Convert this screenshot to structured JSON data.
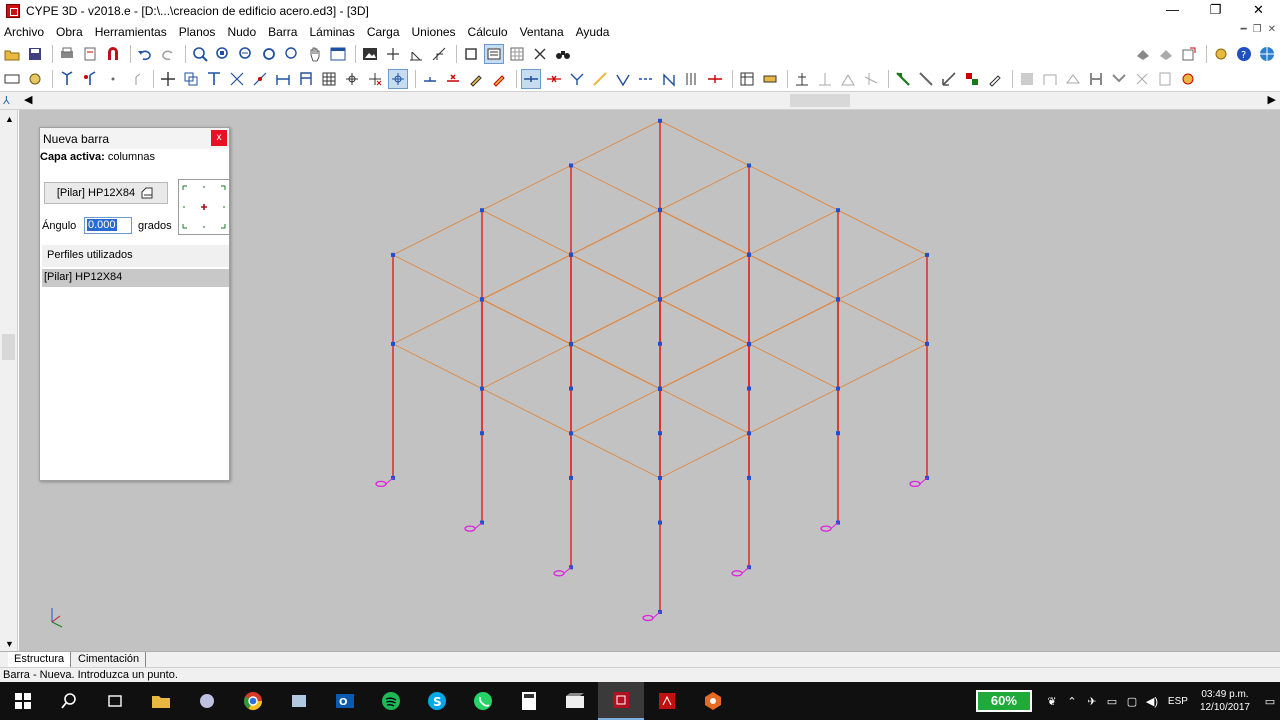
{
  "window": {
    "title": "CYPE 3D - v2018.e - [D:\\...\\creacion de edificio acero.ed3] - [3D]",
    "controls": [
      "—",
      "❐",
      "✕"
    ]
  },
  "menu": {
    "items": [
      "Archivo",
      "Obra",
      "Herramientas",
      "Planos",
      "Nudo",
      "Barra",
      "Láminas",
      "Carga",
      "Uniones",
      "Cálculo",
      "Ventana",
      "Ayuda"
    ]
  },
  "dialog": {
    "title": "Nueva barra",
    "close_label": "x",
    "layer_label": "Capa activa:",
    "layer_value": "columnas",
    "profile_button": "[Pilar] HP12X84",
    "angle_label": "Ángulo",
    "angle_value": "0.000",
    "angle_unit": "grados",
    "list_header": "Perfiles utilizados",
    "list_items": [
      "[Pilar] HP12X84"
    ]
  },
  "tabs": [
    "Estructura",
    "Cimentación"
  ],
  "status": {
    "text": "Barra - Nueva.  Introduzca un punto."
  },
  "taskbar": {
    "battery": "60%",
    "language": "ESP",
    "time": "03:49 p.m.",
    "date": "12/10/2017"
  },
  "colors": {
    "viewport_bg": "#c2c2c2",
    "column": "#e02020",
    "beam": "#e08840",
    "node": "#2050d0",
    "support": "#e020e0"
  }
}
